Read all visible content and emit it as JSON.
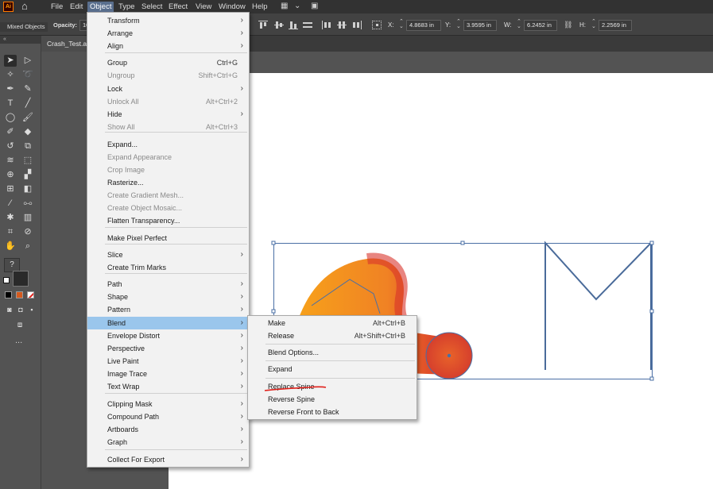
{
  "menubar": {
    "logo": "Ai",
    "items": [
      "File",
      "Edit",
      "Object",
      "Type",
      "Select",
      "Effect",
      "View",
      "Window",
      "Help"
    ],
    "active": "Object"
  },
  "controlbar": {
    "selection_type": "Mixed Objects",
    "opacity_label": "Opacity:",
    "opacity_value": "10",
    "x_label": "X:",
    "x_value": "4.8683 in",
    "y_label": "Y:",
    "y_value": "3.9595 in",
    "w_label": "W:",
    "w_value": "6.2452 in",
    "h_label": "H:",
    "h_value": "2.2569 in"
  },
  "document": {
    "tab_title": "Crash_Test.ai"
  },
  "toolbar": {
    "more_label": "..."
  },
  "object_menu": [
    {
      "label": "Transform",
      "shortcut": "",
      "submenu": true,
      "enabled": true
    },
    {
      "label": "Arrange",
      "shortcut": "",
      "submenu": true,
      "enabled": true
    },
    {
      "label": "Align",
      "shortcut": "",
      "submenu": true,
      "enabled": true
    },
    {
      "label": "Group",
      "shortcut": "Ctrl+G",
      "submenu": false,
      "enabled": true
    },
    {
      "label": "Ungroup",
      "shortcut": "Shift+Ctrl+G",
      "submenu": false,
      "enabled": false
    },
    {
      "label": "Lock",
      "shortcut": "",
      "submenu": true,
      "enabled": true
    },
    {
      "label": "Unlock All",
      "shortcut": "Alt+Ctrl+2",
      "submenu": false,
      "enabled": false
    },
    {
      "label": "Hide",
      "shortcut": "",
      "submenu": true,
      "enabled": true
    },
    {
      "label": "Show All",
      "shortcut": "Alt+Ctrl+3",
      "submenu": false,
      "enabled": false
    },
    {
      "label": "Expand...",
      "shortcut": "",
      "submenu": false,
      "enabled": true
    },
    {
      "label": "Expand Appearance",
      "shortcut": "",
      "submenu": false,
      "enabled": false
    },
    {
      "label": "Crop Image",
      "shortcut": "",
      "submenu": false,
      "enabled": false
    },
    {
      "label": "Rasterize...",
      "shortcut": "",
      "submenu": false,
      "enabled": true
    },
    {
      "label": "Create Gradient Mesh...",
      "shortcut": "",
      "submenu": false,
      "enabled": false
    },
    {
      "label": "Create Object Mosaic...",
      "shortcut": "",
      "submenu": false,
      "enabled": false
    },
    {
      "label": "Flatten Transparency...",
      "shortcut": "",
      "submenu": false,
      "enabled": true
    },
    {
      "label": "Make Pixel Perfect",
      "shortcut": "",
      "submenu": false,
      "enabled": true
    },
    {
      "label": "Slice",
      "shortcut": "",
      "submenu": true,
      "enabled": true
    },
    {
      "label": "Create Trim Marks",
      "shortcut": "",
      "submenu": false,
      "enabled": true
    },
    {
      "label": "Path",
      "shortcut": "",
      "submenu": true,
      "enabled": true
    },
    {
      "label": "Shape",
      "shortcut": "",
      "submenu": true,
      "enabled": true
    },
    {
      "label": "Pattern",
      "shortcut": "",
      "submenu": true,
      "enabled": true
    },
    {
      "label": "Blend",
      "shortcut": "",
      "submenu": true,
      "enabled": true,
      "highlighted": true
    },
    {
      "label": "Envelope Distort",
      "shortcut": "",
      "submenu": true,
      "enabled": true
    },
    {
      "label": "Perspective",
      "shortcut": "",
      "submenu": true,
      "enabled": true
    },
    {
      "label": "Live Paint",
      "shortcut": "",
      "submenu": true,
      "enabled": true
    },
    {
      "label": "Image Trace",
      "shortcut": "",
      "submenu": true,
      "enabled": true
    },
    {
      "label": "Text Wrap",
      "shortcut": "",
      "submenu": true,
      "enabled": true
    },
    {
      "label": "Clipping Mask",
      "shortcut": "",
      "submenu": true,
      "enabled": true
    },
    {
      "label": "Compound Path",
      "shortcut": "",
      "submenu": true,
      "enabled": true
    },
    {
      "label": "Artboards",
      "shortcut": "",
      "submenu": true,
      "enabled": true
    },
    {
      "label": "Graph",
      "shortcut": "",
      "submenu": true,
      "enabled": true
    },
    {
      "label": "Collect For Export",
      "shortcut": "",
      "submenu": true,
      "enabled": true
    }
  ],
  "blend_menu": [
    {
      "label": "Make",
      "shortcut": "Alt+Ctrl+B"
    },
    {
      "label": "Release",
      "shortcut": "Alt+Shift+Ctrl+B"
    },
    {
      "label": "Blend Options...",
      "shortcut": ""
    },
    {
      "label": "Expand",
      "shortcut": ""
    },
    {
      "label": "Replace Spine",
      "shortcut": "",
      "annotated": true
    },
    {
      "label": "Reverse Spine",
      "shortcut": ""
    },
    {
      "label": "Reverse Front to Back",
      "shortcut": ""
    }
  ],
  "colors": {
    "menu_bg": "#f2f2f2",
    "highlight": "#9ac6ec",
    "blend_gradient_start": "#f7a21a",
    "blend_gradient_end": "#d8342c",
    "selection_blue": "#4a6fa5",
    "annotation_red": "#e0201a"
  }
}
